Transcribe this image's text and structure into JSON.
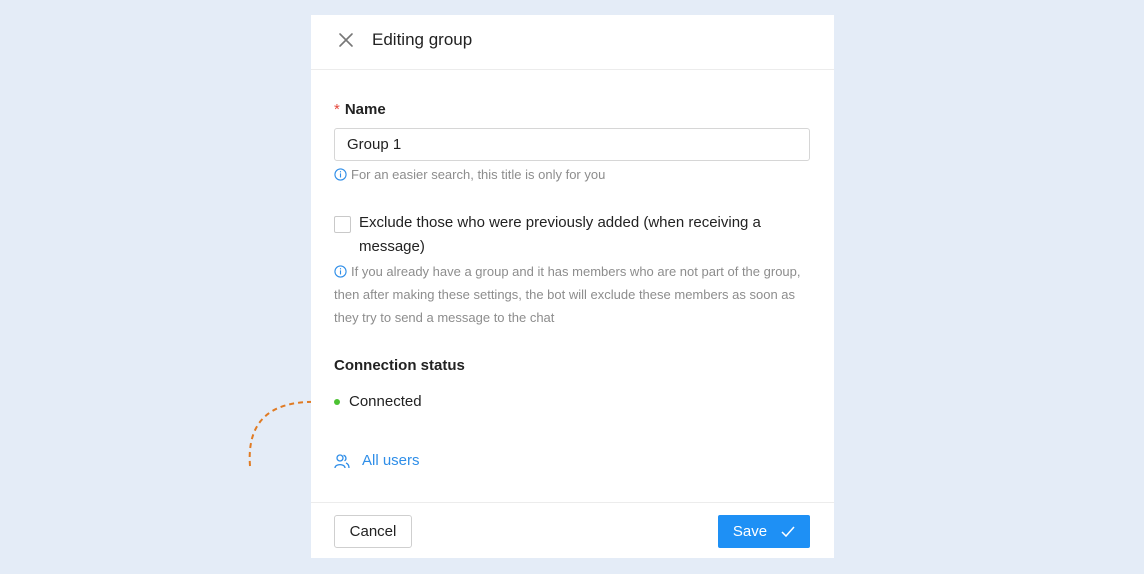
{
  "modal": {
    "title": "Editing group"
  },
  "form": {
    "name_required_mark": "*",
    "name_label": "Name",
    "name_value": "Group 1",
    "name_hint": "For an easier search, this title is only for you",
    "exclude_label": "Exclude those who were previously added (when receiving a message)",
    "exclude_checked": false,
    "exclude_hint": "If you already have a group and it has members who are not part of the group, then after making these settings, the bot will exclude these members as soon as they try to send a message to the chat"
  },
  "connection": {
    "label": "Connection status",
    "status": "Connected",
    "status_color": "#4cc233"
  },
  "links": {
    "all_users": "All users"
  },
  "footer": {
    "cancel_label": "Cancel",
    "save_label": "Save"
  },
  "icons": {
    "close": "close-icon",
    "info": "info-icon",
    "users": "users-icon",
    "check": "check-icon"
  },
  "colors": {
    "accent": "#1e90f5",
    "link": "#2f8ee8",
    "required": "#e5483c",
    "annotation_arrow": "#e07b24",
    "background": "#e4ecf7"
  }
}
